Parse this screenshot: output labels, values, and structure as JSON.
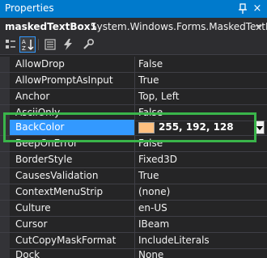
{
  "titlebar": {
    "title": "Properties",
    "close_icon": "×"
  },
  "object_selector": {
    "name": "maskedTextBox1",
    "type": "System.Windows.Forms.MaskedTextBox"
  },
  "toolbar": {
    "buttons": [
      "categorized-icon",
      "alphabetical-icon",
      "properties-icon",
      "events-icon"
    ]
  },
  "properties": [
    {
      "name": "AllowDrop",
      "value": "False"
    },
    {
      "name": "AllowPromptAsInput",
      "value": "True"
    },
    {
      "name": "Anchor",
      "value": "Top, Left"
    },
    {
      "name": "AsciiOnly",
      "value": "False"
    },
    {
      "name": "BackColor",
      "value": "255, 192, 128",
      "swatch": "#ffc080"
    },
    {
      "name": "BeepOnError",
      "value": "False"
    },
    {
      "name": "BorderStyle",
      "value": "Fixed3D"
    },
    {
      "name": "CausesValidation",
      "value": "True"
    },
    {
      "name": "ContextMenuStrip",
      "value": "(none)"
    },
    {
      "name": "Culture",
      "value": "en-US"
    },
    {
      "name": "Cursor",
      "value": "IBeam"
    },
    {
      "name": "CutCopyMaskFormat",
      "value": "IncludeLiterals"
    },
    {
      "name": "Dock",
      "value": "None"
    }
  ],
  "colors": {
    "accent": "#007acc",
    "selection": "#3399ff",
    "highlight_box": "#3ab54a",
    "background": "#252526"
  }
}
